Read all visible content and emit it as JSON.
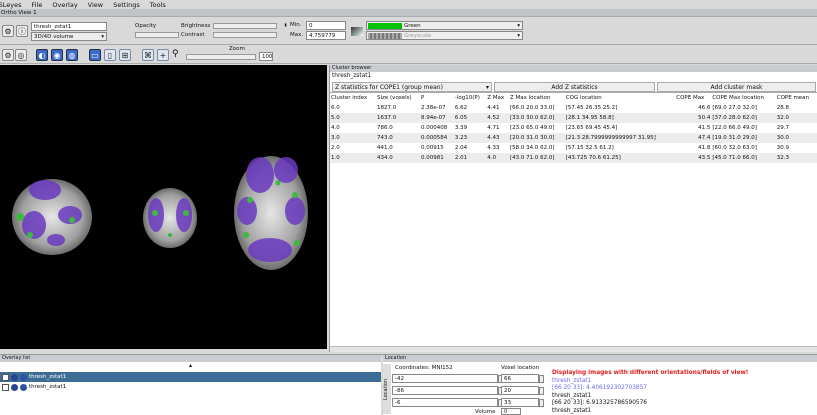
{
  "menubar": {
    "items": [
      "FSLeyes",
      "File",
      "Overlay",
      "View",
      "Settings",
      "Tools"
    ]
  },
  "view_title": "Ortho View 1",
  "controls": {
    "overlay_name": "thresh_zstat1",
    "overlay_type": "3D/4D volume",
    "opacity_label": "Opacity",
    "brightness_label": "Brightness",
    "contrast_label": "Contrast",
    "min_label": "Min.",
    "min_value": "0",
    "max_label": "Max.",
    "max_value": "4.759779",
    "cmap_primary": "Green",
    "cmap_secondary": "Greyscale",
    "colors": {
      "green": "#00c200"
    }
  },
  "toolbar": {
    "zoom_label": "Zoom",
    "zoom_value": "100"
  },
  "cluster_browser": {
    "panel_title": "Cluster browser",
    "overlay_name": "thresh_zstat1",
    "dataset_select": "Z statistics for COPE1 (group mean)",
    "add_z_button": "Add Z statistics",
    "add_cluster_button": "Add cluster mask",
    "headers": [
      "Cluster index",
      "Size (voxels)",
      "P",
      "-log10(P)",
      "Z Max",
      "Z Max location",
      "COG location",
      "COPE Max",
      "COPE Max location",
      "COPE mean"
    ],
    "rows": [
      [
        "6.0",
        "1827.0",
        "2.38e-07",
        "6.62",
        "4.41",
        "[66.0 20.0 33.0]",
        "[57.45 26.35 25.2]",
        "46.6",
        "[69.0 27.0 32.0]",
        "28.8"
      ],
      [
        "5.0",
        "1637.0",
        "8.94e-07",
        "6.05",
        "4.52",
        "[33.0 30.0 62.0]",
        "[28.1 34.95 58.8]",
        "50.4",
        "[37.0 28.0 62.0]",
        "32.0"
      ],
      [
        "4.0",
        "786.0",
        "0.000408",
        "3.39",
        "4.71",
        "[23.0 65.0 49.0]",
        "[23.65 69.45 45.4]",
        "41.5",
        "[22.0 66.0 49.0]",
        "29.7"
      ],
      [
        "3.0",
        "743.0",
        "0.000584",
        "3.23",
        "4.43",
        "[20.0 31.0 30.0]",
        "[21.3 28.7999999999997 31.95]",
        "47.4",
        "[19.0 31.0 29.0]",
        "30.0"
      ],
      [
        "2.0",
        "441.0",
        "0.00915",
        "2.04",
        "4.33",
        "[58.0 34.0 62.0]",
        "[57.15 32.5 61.2]",
        "41.8",
        "[60.0 32.0 63.0]",
        "30.9"
      ],
      [
        "1.0",
        "434.0",
        "0.00981",
        "2.01",
        "4.0",
        "[43.0 71.0 62.0]",
        "[43.725 70.6 61.25]",
        "43.5",
        "[45.0 71.0 66.0]",
        "32.3"
      ]
    ]
  },
  "overlay_list": {
    "panel_title": "Overlay list",
    "items": [
      "thresh_zstat1",
      "thresh_zstat1"
    ]
  },
  "location": {
    "panel_title": "Location",
    "coords_label": "Coordinates: MNI152",
    "voxel_label": "Voxel location",
    "coords": [
      "-42",
      "-86",
      "-6"
    ],
    "voxels": [
      "66",
      "20",
      "33"
    ],
    "volume_label": "Volume",
    "volume_value": "0",
    "side_label": "Location"
  },
  "info": {
    "warning": "Displaying images with different orientations/fields of view!",
    "lines": [
      {
        "text": "thresh_zstat1",
        "color": "#6a6af0"
      },
      {
        "text": "[66 20 33]: 4.406192302703857",
        "color": "#6a6af0"
      },
      {
        "text": "thresh_zstat1",
        "color": "#111111"
      },
      {
        "text": "[66 20 33]: 6.913325786590576",
        "color": "#111111"
      },
      {
        "text": "thresh_zstat1",
        "color": "#111111"
      }
    ]
  }
}
